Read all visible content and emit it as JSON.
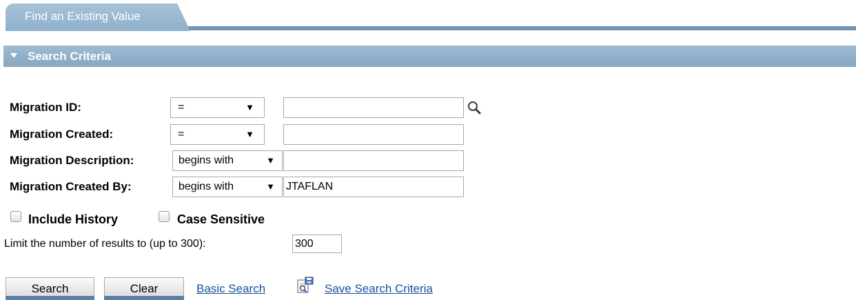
{
  "tab": {
    "label": "Find an Existing Value"
  },
  "section": {
    "title": "Search Criteria"
  },
  "criteria": [
    {
      "label": "Migration ID:",
      "operator": "=",
      "value": ""
    },
    {
      "label": "Migration Created:",
      "operator": "=",
      "value": ""
    },
    {
      "label": "Migration Description:",
      "operator": "begins with",
      "value": ""
    },
    {
      "label": "Migration Created By:",
      "operator": "begins with",
      "value": "JTAFLAN"
    }
  ],
  "options": {
    "include_history": {
      "label": "Include History",
      "checked": false
    },
    "case_sensitive": {
      "label": "Case Sensitive",
      "checked": false
    }
  },
  "limit": {
    "label": "Limit the number of results to (up to 300):",
    "value": "300"
  },
  "actions": {
    "search": "Search",
    "clear": "Clear",
    "basic_search": "Basic Search",
    "save_search_criteria": "Save Search Criteria"
  },
  "icons": {
    "dropdown_arrow": "▼",
    "lookup": "magnifier-icon",
    "save": "save-criteria-icon"
  },
  "colors": {
    "tab": "#99b7d0",
    "header_bar": "#8dacc7",
    "link": "#174f9e"
  }
}
